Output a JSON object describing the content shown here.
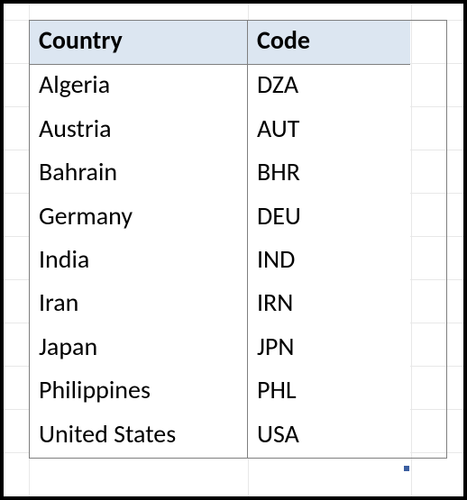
{
  "table": {
    "headers": {
      "country": "Country",
      "code": "Code"
    },
    "rows": [
      {
        "country": "Algeria",
        "code": "DZA"
      },
      {
        "country": "Austria",
        "code": "AUT"
      },
      {
        "country": "Bahrain",
        "code": "BHR"
      },
      {
        "country": "Germany",
        "code": "DEU"
      },
      {
        "country": "India",
        "code": "IND"
      },
      {
        "country": "Iran",
        "code": "IRN"
      },
      {
        "country": "Japan",
        "code": "JPN"
      },
      {
        "country": "Philippines",
        "code": "PHL"
      },
      {
        "country": "United States",
        "code": "USA"
      }
    ]
  }
}
